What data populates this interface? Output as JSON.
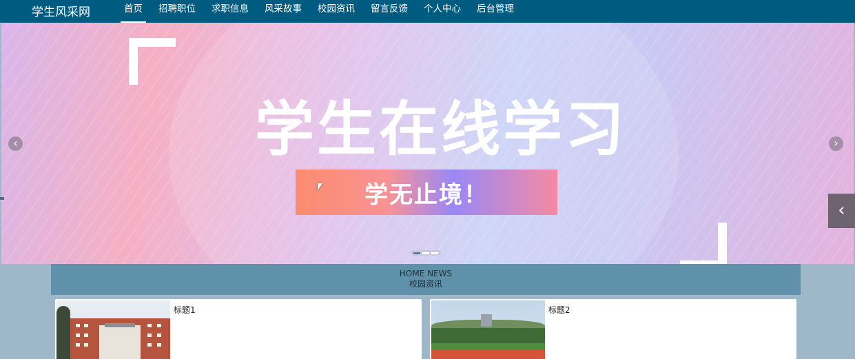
{
  "site": {
    "logo": "学生风采网"
  },
  "nav": {
    "items": [
      {
        "label": "首页",
        "active": true
      },
      {
        "label": "招聘职位",
        "active": false
      },
      {
        "label": "求职信息",
        "active": false
      },
      {
        "label": "风采故事",
        "active": false
      },
      {
        "label": "校园资讯",
        "active": false
      },
      {
        "label": "留言反馈",
        "active": false
      },
      {
        "label": "个人中心",
        "active": false
      },
      {
        "label": "后台管理",
        "active": false
      }
    ]
  },
  "banner": {
    "headline": "学生在线学习",
    "slogan": "学无止境！",
    "prev_icon": "‹",
    "next_icon": "›",
    "slide_count": 3,
    "active_slide": 0
  },
  "side_toggle": {
    "icon": "‹"
  },
  "news": {
    "heading_en": "HOME NEWS",
    "heading_cn": "校园资讯",
    "cards": [
      {
        "title": "标题1",
        "image": "campus-building"
      },
      {
        "title": "标题2",
        "image": "sports-field"
      }
    ]
  },
  "colors": {
    "topbar": "#005b80",
    "page_bg": "#9eb7c9",
    "news_header": "#5f91ab",
    "accent": "#ffffff"
  }
}
